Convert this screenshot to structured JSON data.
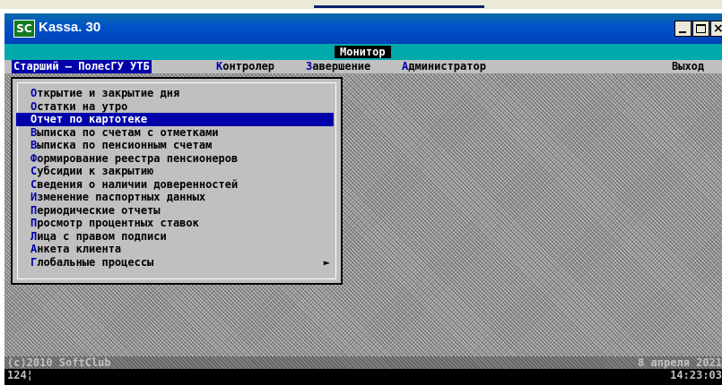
{
  "window": {
    "title": "Kassa. 30",
    "icon": "app-sc-icon",
    "icon_text": "SC"
  },
  "header": {
    "monitor_label": "Монитор"
  },
  "menubar": {
    "role": "Старший – ПолесГУ УТБ",
    "items": [
      {
        "hot": "К",
        "rest": "онтролер"
      },
      {
        "hot": "З",
        "rest": "авершение"
      },
      {
        "hot": "А",
        "rest": "дминистратор"
      }
    ],
    "exit": "Выход"
  },
  "menu": {
    "selected_index": 2,
    "items": [
      {
        "hot": "О",
        "rest": "ткрытие и закрытие дня"
      },
      {
        "hot": "О",
        "rest": "статки на утро"
      },
      {
        "hot": "О",
        "rest": "тчет по картотеке"
      },
      {
        "hot": "В",
        "rest": "ыписка по счетам с отметками"
      },
      {
        "hot": "В",
        "rest": "ыписка по пенсионным счетам"
      },
      {
        "hot": "Ф",
        "rest": "ормирование реестра пенсионеров"
      },
      {
        "hot": "С",
        "rest": "убсидии к закрытию"
      },
      {
        "hot": "С",
        "rest": "ведения о наличии доверенностей"
      },
      {
        "hot": "И",
        "rest": "зменение паспортных данных"
      },
      {
        "hot": "П",
        "rest": "ериодические отчеты"
      },
      {
        "hot": "П",
        "rest": "росмотр процентных ставок"
      },
      {
        "hot": "Л",
        "rest": "ица с правом подписи"
      },
      {
        "hot": "А",
        "rest": "нкета клиента"
      },
      {
        "hot": "Г",
        "rest": "лобальные процессы",
        "arrow": "►"
      }
    ]
  },
  "footer": {
    "copyright": "(c)2010 SoftClub",
    "code": "124¦",
    "date": "8 апреля 2021",
    "time": "14:23:03"
  },
  "colors": {
    "accent": "#0000aa",
    "teal": "#00aaaa",
    "menu_bg": "#c0c0c0"
  }
}
